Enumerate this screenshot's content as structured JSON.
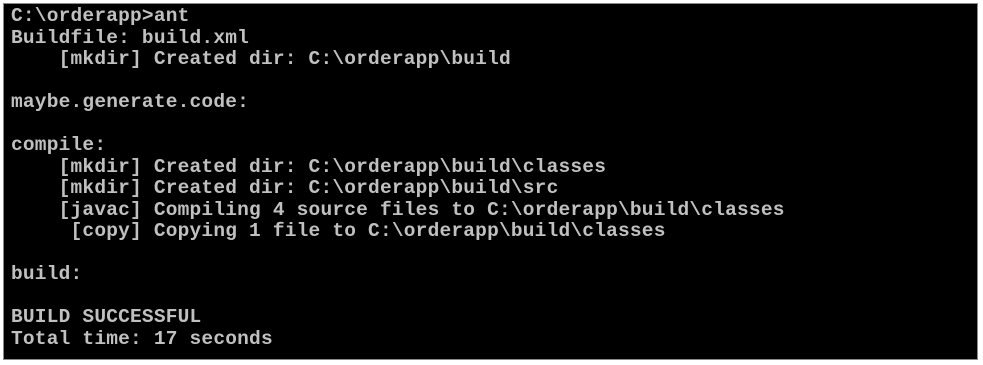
{
  "console": {
    "colors": {
      "background": "#000000",
      "text": "#c0c0c0",
      "frame": "#8a8a8a"
    },
    "lines": [
      "C:\\orderapp>ant",
      "Buildfile: build.xml",
      "    [mkdir] Created dir: C:\\orderapp\\build",
      "",
      "maybe.generate.code:",
      "",
      "compile:",
      "    [mkdir] Created dir: C:\\orderapp\\build\\classes",
      "    [mkdir] Created dir: C:\\orderapp\\build\\src",
      "    [javac] Compiling 4 source files to C:\\orderapp\\build\\classes",
      "     [copy] Copying 1 file to C:\\orderapp\\build\\classes",
      "",
      "build:",
      "",
      "BUILD SUCCESSFUL",
      "Total time: 17 seconds"
    ]
  }
}
